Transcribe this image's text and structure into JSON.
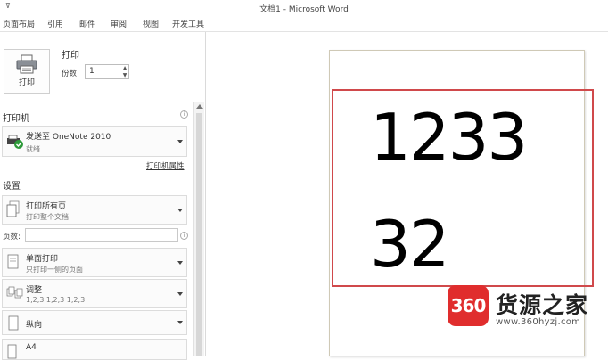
{
  "titlebar": {
    "quick_access": "⊽",
    "title": "文档1 - Microsoft Word"
  },
  "menu": {
    "tabs": [
      "页面布局",
      "引用",
      "邮件",
      "审阅",
      "视图",
      "开发工具"
    ]
  },
  "print": {
    "button_label": "打印",
    "heading": "打印",
    "copies_label": "份数:",
    "copies_value": "1"
  },
  "printer": {
    "heading": "打印机",
    "name": "发送至 OneNote 2010",
    "status": "就绪",
    "properties_link": "打印机属性"
  },
  "settings": {
    "heading": "设置",
    "pages_range": {
      "main": "打印所有页",
      "sub": "打印整个文档"
    },
    "pages_label": "页数:",
    "pages_value": "",
    "sides": {
      "main": "单面打印",
      "sub": "只打印一侧的页面"
    },
    "collate": {
      "main": "调整",
      "sub": "1,2,3    1,2,3    1,2,3"
    },
    "orientation": {
      "main": "纵向"
    },
    "paper": {
      "main": "A4"
    }
  },
  "document": {
    "line1": "1233",
    "line2": "32"
  },
  "watermark": {
    "logo_text": "360",
    "name": "货源之家",
    "url": "www.360hyzj.com"
  }
}
